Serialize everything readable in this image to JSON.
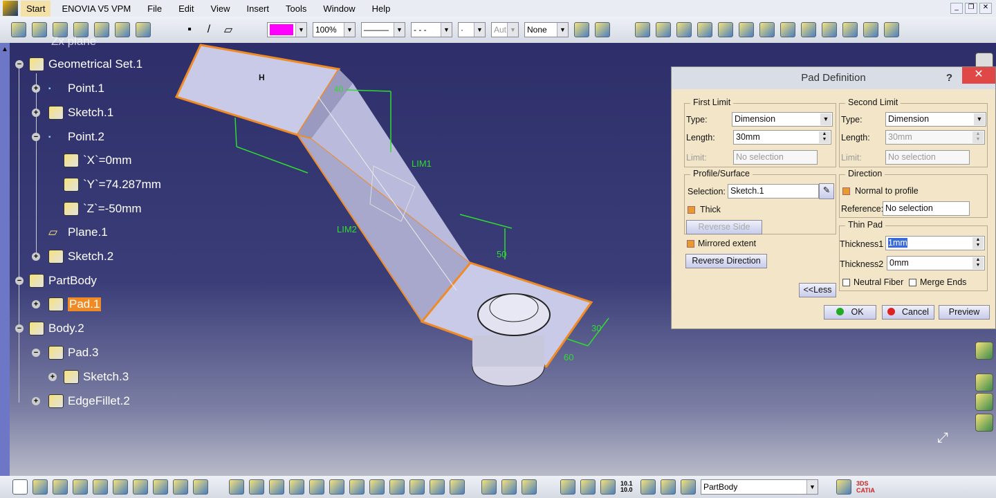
{
  "menu": [
    "Start",
    "ENOVIA V5 VPM",
    "File",
    "Edit",
    "View",
    "Insert",
    "Tools",
    "Window",
    "Help"
  ],
  "toolbar": {
    "color": "#ff00ff",
    "opacity": "100%",
    "linetype": "———",
    "dashtype": "- - -",
    "point": "·",
    "auto": "Aut",
    "none": "None"
  },
  "tree": [
    {
      "label": "Zx plane",
      "level": 2
    },
    {
      "label": "Geometrical Set.1",
      "level": 1
    },
    {
      "label": "Point.1",
      "level": 2
    },
    {
      "label": "Sketch.1",
      "level": 2
    },
    {
      "label": "Point.2",
      "level": 2
    },
    {
      "label": "`X`=0mm",
      "level": 3
    },
    {
      "label": "`Y`=74.287mm",
      "level": 3
    },
    {
      "label": "`Z`=-50mm",
      "level": 3
    },
    {
      "label": "Plane.1",
      "level": 2
    },
    {
      "label": "Sketch.2",
      "level": 2
    },
    {
      "label": "PartBody",
      "level": 1
    },
    {
      "label": "Pad.1",
      "level": 2,
      "selected": true
    },
    {
      "label": "Body.2",
      "level": 1
    },
    {
      "label": "Pad.3",
      "level": 2
    },
    {
      "label": "Sketch.3",
      "level": 3
    },
    {
      "label": "EdgeFillet.2",
      "level": 2
    }
  ],
  "model": {
    "labels": [
      "H",
      "40",
      "LIM1",
      "LIM2",
      "50",
      "30",
      "60"
    ]
  },
  "dialog": {
    "title": "Pad Definition",
    "help": "?",
    "close": "✕",
    "first_limit": {
      "title": "First Limit",
      "type_label": "Type:",
      "type": "Dimension",
      "length_label": "Length:",
      "length": "30mm",
      "limit_label": "Limit:",
      "limit": "No selection"
    },
    "second_limit": {
      "title": "Second Limit",
      "type_label": "Type:",
      "type": "Dimension",
      "length_label": "Length:",
      "length": "30mm",
      "limit_label": "Limit:",
      "limit": "No selection"
    },
    "profile": {
      "title": "Profile/Surface",
      "selection_label": "Selection:",
      "selection": "Sketch.1",
      "thick": "Thick",
      "reverse_side": "Reverse Side"
    },
    "direction": {
      "title": "Direction",
      "normal": "Normal to profile",
      "reference_label": "Reference:",
      "reference": "No selection"
    },
    "thin_pad": {
      "title": "Thin Pad",
      "thickness1_label": "Thickness1",
      "thickness1": "1mm",
      "thickness2_label": "Thickness2",
      "thickness2": "0mm",
      "neutral": "Neutral Fiber",
      "merge": "Merge Ends"
    },
    "mirrored": "Mirrored extent",
    "reverse_direction": "Reverse Direction",
    "less": "<<Less",
    "ok": "OK",
    "cancel": "Cancel",
    "preview": "Preview"
  },
  "bottom": {
    "current_body": "PartBody",
    "scale": "10.1 10.0"
  }
}
